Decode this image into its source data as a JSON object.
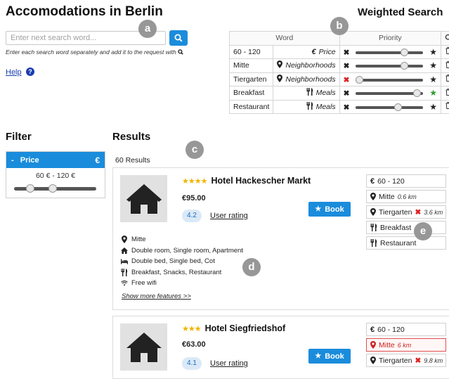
{
  "page": {
    "title": "Accomodations in Berlin"
  },
  "search": {
    "placeholder": "Enter next search word...",
    "hint": "Enter each search word separately and add it to the request with",
    "help_label": "Help",
    "help_q": "?"
  },
  "weighted": {
    "title": "Weighted Search",
    "col_word": "Word",
    "col_priority": "Priority",
    "rows": [
      {
        "word": "60 - 120",
        "icon": "euro-icon",
        "icon_glyph": "€",
        "category": "Price",
        "priority": 0.75,
        "x_color": "#222222",
        "star_color": "#222222"
      },
      {
        "word": "Mitte",
        "icon": "map-marker-icon",
        "icon_glyph": "",
        "category": "Neighborhoods",
        "priority": 0.75,
        "x_color": "#222222",
        "star_color": "#222222"
      },
      {
        "word": "Tiergarten",
        "icon": "map-marker-icon",
        "icon_glyph": "",
        "category": "Neighborhoods",
        "priority": 0.0,
        "x_color": "#dd2222",
        "star_color": "#222222"
      },
      {
        "word": "Breakfast",
        "icon": "cutlery-icon",
        "icon_glyph": "",
        "category": "Meals",
        "priority": 0.97,
        "x_color": "#222222",
        "star_color": "#2e9a2e"
      },
      {
        "word": "Restaurant",
        "icon": "cutlery-icon",
        "icon_glyph": "",
        "category": "Meals",
        "priority": 0.65,
        "x_color": "#222222",
        "star_color": "#222222"
      }
    ]
  },
  "filter": {
    "title": "Filter",
    "price_label": "Price",
    "price_symbol": "€",
    "range_text": "60 € - 120 €",
    "range_low": 0.2,
    "range_high": 0.47
  },
  "results": {
    "title": "Results",
    "count": "60 Results",
    "hotels": [
      {
        "name": "Hotel Hackescher Markt",
        "stars": "★★★★",
        "price": "€95.00",
        "rating": "4.2",
        "rating_label": "User rating",
        "book": "Book",
        "tags": [
          {
            "icon": "euro-icon",
            "text": "60 - 120",
            "dist": "",
            "x": false,
            "red": false
          },
          {
            "icon": "map-marker-icon",
            "text": "Mitte",
            "dist": "0.6 km",
            "x": false,
            "red": false
          },
          {
            "icon": "map-marker-icon",
            "text": "Tiergarten",
            "dist": "3.6 km",
            "x": true,
            "red": false
          },
          {
            "icon": "cutlery-icon",
            "text": "Breakfast",
            "dist": "",
            "x": false,
            "red": false
          },
          {
            "icon": "cutlery-icon",
            "text": "Restaurant",
            "dist": "",
            "x": false,
            "red": false
          }
        ],
        "features": [
          {
            "icon": "map-marker-icon",
            "text": "Mitte"
          },
          {
            "icon": "home-icon",
            "text": "Double room, Single room, Apartment"
          },
          {
            "icon": "bed-icon",
            "text": "Double bed, Single bed, Cot"
          },
          {
            "icon": "cutlery-icon",
            "text": "Breakfast, Snacks, Restaurant"
          },
          {
            "icon": "wifi-icon",
            "text": "Free wifi"
          }
        ],
        "show_more": "Show more features >>"
      },
      {
        "name": "Hotel Siegfriedshof",
        "stars": "★★★",
        "price": "€63.00",
        "rating": "4.1",
        "rating_label": "User rating",
        "book": "Book",
        "tags": [
          {
            "icon": "euro-icon",
            "text": "60 - 120",
            "dist": "",
            "x": false,
            "red": false
          },
          {
            "icon": "map-marker-icon",
            "text": "Mitte",
            "dist": "6 km",
            "x": false,
            "red": true
          },
          {
            "icon": "map-marker-icon",
            "text": "Tiergarten",
            "dist": "9.8 km",
            "x": true,
            "red": false
          }
        ]
      }
    ]
  },
  "markers": {
    "a": "a",
    "b": "b",
    "c": "c",
    "d": "d",
    "e": "e"
  }
}
